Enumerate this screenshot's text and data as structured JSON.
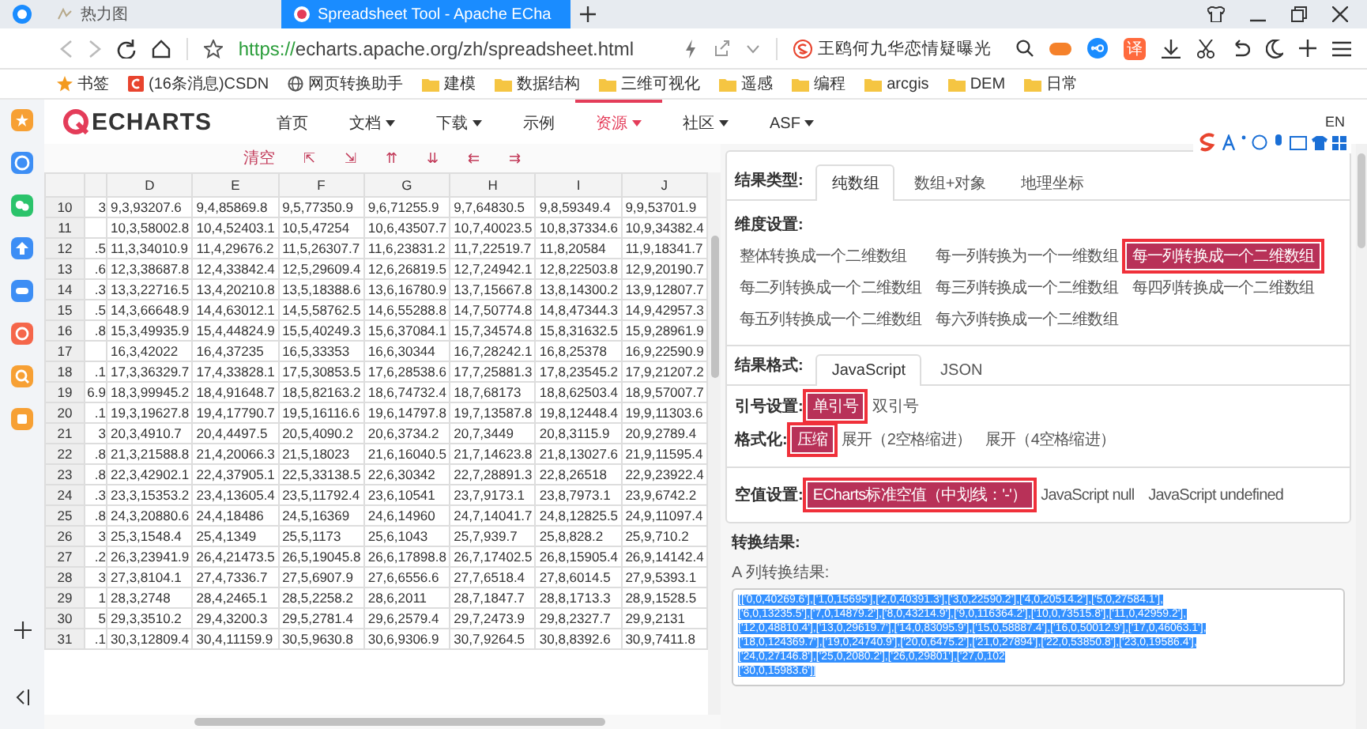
{
  "browser": {
    "tabs": [
      {
        "title": "热力图",
        "selected": false
      },
      {
        "title": "Spreadsheet Tool - Apache ECha",
        "selected": true
      }
    ],
    "url_scheme": "https://",
    "url_host": "echarts.apache.org",
    "url_path": "/zh/spreadsheet.html",
    "search_query": "王鸥何九华恋情疑曝光",
    "translate_label": "译",
    "bookmarks": [
      {
        "label": "书签",
        "kind": "star"
      },
      {
        "label": "(16条消息)CSDN",
        "kind": "csdn"
      },
      {
        "label": "网页转换助手",
        "kind": "globe"
      },
      {
        "label": "建模",
        "kind": "folder"
      },
      {
        "label": "数据结构",
        "kind": "folder"
      },
      {
        "label": "三维可视化",
        "kind": "folder"
      },
      {
        "label": "遥感",
        "kind": "folder"
      },
      {
        "label": "编程",
        "kind": "folder"
      },
      {
        "label": "arcgis",
        "kind": "folder"
      },
      {
        "label": "DEM",
        "kind": "folder"
      },
      {
        "label": "日常",
        "kind": "folder"
      }
    ]
  },
  "site": {
    "logo_text": "ECHARTS",
    "language": "EN",
    "nav": [
      {
        "label": "首页",
        "selected": false,
        "dropdown": false
      },
      {
        "label": "文档",
        "selected": false,
        "dropdown": true
      },
      {
        "label": "下载",
        "selected": false,
        "dropdown": true
      },
      {
        "label": "示例",
        "selected": false,
        "dropdown": false
      },
      {
        "label": "资源",
        "selected": true,
        "dropdown": true
      },
      {
        "label": "社区",
        "selected": false,
        "dropdown": true
      },
      {
        "label": "ASF",
        "selected": false,
        "dropdown": true
      }
    ]
  },
  "toolbar": {
    "clear": "清空",
    "tools": [
      "⇱",
      "⇲",
      "⇈",
      "⇊",
      "⇇",
      "⇉"
    ]
  },
  "table": {
    "columns": [
      "D",
      "E",
      "F",
      "G",
      "H",
      "I",
      "J"
    ],
    "rows": [
      {
        "number": "10",
        "partial": "3",
        "cells": [
          "9,3,93207.6",
          "9,4,85869.8",
          "9,5,77350.9",
          "9,6,71255.9",
          "9,7,64830.5",
          "9,8,59349.4",
          "9,9,53701.9"
        ]
      },
      {
        "number": "11",
        "cells": [
          "10,3,58002.8",
          "10,4,52403.1",
          "10,5,47254",
          "10,6,43507.7",
          "10,7,40023.5",
          "10,8,37334.6",
          "10,9,34382.4"
        ]
      },
      {
        "number": "12",
        "partial": ".5",
        "cells": [
          "11,3,34010.9",
          "11,4,29676.2",
          "11,5,26307.7",
          "11,6,23831.2",
          "11,7,22519.7",
          "11,8,20584",
          "11,9,18341.7"
        ]
      },
      {
        "number": "13",
        "partial": ".6",
        "cells": [
          "12,3,38687.8",
          "12,4,33842.4",
          "12,5,29609.4",
          "12,6,26819.5",
          "12,7,24942.1",
          "12,8,22503.8",
          "12,9,20190.7"
        ]
      },
      {
        "number": "14",
        "partial": ".3",
        "cells": [
          "13,3,22716.5",
          "13,4,20210.8",
          "13,5,18388.6",
          "13,6,16780.9",
          "13,7,15667.8",
          "13,8,14300.2",
          "13,9,12807.7"
        ]
      },
      {
        "number": "15",
        "partial": ".5",
        "cells": [
          "14,3,66648.9",
          "14,4,63012.1",
          "14,5,58762.5",
          "14,6,55288.8",
          "14,7,50774.8",
          "14,8,47344.3",
          "14,9,42957.3"
        ]
      },
      {
        "number": "16",
        "partial": ".8",
        "cells": [
          "15,3,49935.9",
          "15,4,44824.9",
          "15,5,40249.3",
          "15,6,37084.1",
          "15,7,34574.8",
          "15,8,31632.5",
          "15,9,28961.9"
        ]
      },
      {
        "number": "17",
        "cells": [
          "16,3,42022",
          "16,4,37235",
          "16,5,33353",
          "16,6,30344",
          "16,7,28242.1",
          "16,8,25378",
          "16,9,22590.9"
        ]
      },
      {
        "number": "18",
        "partial": ".1",
        "cells": [
          "17,3,36329.7",
          "17,4,33828.1",
          "17,5,30853.5",
          "17,6,28538.6",
          "17,7,25881.3",
          "17,8,23545.2",
          "17,9,21207.2"
        ]
      },
      {
        "number": "19",
        "partial": "6.9",
        "cells": [
          "18,3,99945.2",
          "18,4,91648.7",
          "18,5,82163.2",
          "18,6,74732.4",
          "18,7,68173",
          "18,8,62503.4",
          "18,9,57007.7"
        ]
      },
      {
        "number": "20",
        "partial": ".1",
        "cells": [
          "19,3,19627.8",
          "19,4,17790.7",
          "19,5,16116.6",
          "19,6,14797.8",
          "19,7,13587.8",
          "19,8,12448.4",
          "19,9,11303.6"
        ]
      },
      {
        "number": "21",
        "partial": "3",
        "cells": [
          "20,3,4910.7",
          "20,4,4497.5",
          "20,5,4090.2",
          "20,6,3734.2",
          "20,7,3449",
          "20,8,3115.9",
          "20,9,2789.4"
        ]
      },
      {
        "number": "22",
        "partial": ".8",
        "cells": [
          "21,3,21588.8",
          "21,4,20066.3",
          "21,5,18023",
          "21,6,16040.5",
          "21,7,14623.8",
          "21,8,13027.6",
          "21,9,11595.4"
        ]
      },
      {
        "number": "23",
        "partial": ".8",
        "cells": [
          "22,3,42902.1",
          "22,4,37905.1",
          "22,5,33138.5",
          "22,6,30342",
          "22,7,28891.3",
          "22,8,26518",
          "22,9,23922.4"
        ]
      },
      {
        "number": "24",
        "partial": ".3",
        "cells": [
          "23,3,15353.2",
          "23,4,13605.4",
          "23,5,11792.4",
          "23,6,10541",
          "23,7,9173.1",
          "23,8,7973.1",
          "23,9,6742.2"
        ]
      },
      {
        "number": "25",
        "partial": ".8",
        "cells": [
          "24,3,20880.6",
          "24,4,18486",
          "24,5,16369",
          "24,6,14960",
          "24,7,14041.7",
          "24,8,12825.5",
          "24,9,11097.4"
        ]
      },
      {
        "number": "26",
        "partial": "3",
        "cells": [
          "25,3,1548.4",
          "25,4,1349",
          "25,5,1173",
          "25,6,1043",
          "25,7,939.7",
          "25,8,828.2",
          "25,9,710.2"
        ]
      },
      {
        "number": "27",
        "partial": ".2",
        "cells": [
          "26,3,23941.9",
          "26,4,21473.5",
          "26,5,19045.8",
          "26,6,17898.8",
          "26,7,17402.5",
          "26,8,15905.4",
          "26,9,14142.4"
        ]
      },
      {
        "number": "28",
        "partial": "3",
        "cells": [
          "27,3,8104.1",
          "27,4,7336.7",
          "27,5,6907.9",
          "27,6,6556.6",
          "27,7,6518.4",
          "27,8,6014.5",
          "27,9,5393.1"
        ]
      },
      {
        "number": "29",
        "partial": "1",
        "cells": [
          "28,3,2748",
          "28,4,2465.1",
          "28,5,2258.2",
          "28,6,2011",
          "28,7,1847.7",
          "28,8,1713.3",
          "28,9,1528.5"
        ]
      },
      {
        "number": "30",
        "partial": "5",
        "cells": [
          "29,3,3510.2",
          "29,4,3200.3",
          "29,5,2781.4",
          "29,6,2579.4",
          "29,7,2473.9",
          "29,8,2327.7",
          "29,9,2131"
        ]
      },
      {
        "number": "31",
        "partial": ".1",
        "cells": [
          "30,3,12809.4",
          "30,4,11159.9",
          "30,5,9630.8",
          "30,6,9306.9",
          "30,7,9264.5",
          "30,8,8392.6",
          "30,9,7411.8"
        ]
      }
    ]
  },
  "settings": {
    "result_type": {
      "label": "结果类型:",
      "tabs": [
        {
          "label": "纯数组",
          "selected": true
        },
        {
          "label": "数组+对象",
          "selected": false
        },
        {
          "label": "地理坐标",
          "selected": false
        }
      ]
    },
    "dimension": {
      "label": "维度设置:",
      "options": [
        {
          "label": "整体转换成一个二维数组",
          "selected": false
        },
        {
          "label": "每一列转换为一个一维数组",
          "selected": false
        },
        {
          "label": "每一列转换成一个二维数组",
          "selected": true
        },
        {
          "label": "每二列转换成一个二维数组",
          "selected": false
        },
        {
          "label": "每三列转换成一个二维数组",
          "selected": false
        },
        {
          "label": "每四列转换成一个二维数组",
          "selected": false
        },
        {
          "label": "每五列转换成一个二维数组",
          "selected": false
        },
        {
          "label": "每六列转换成一个二维数组",
          "selected": false
        }
      ]
    },
    "result_format": {
      "label": "结果格式:",
      "tabs": [
        {
          "label": "JavaScript",
          "selected": true
        },
        {
          "label": "JSON",
          "selected": false
        }
      ]
    },
    "quotes": {
      "label": "引号设置:",
      "options": [
        {
          "label": "单引号",
          "selected": true
        },
        {
          "label": "双引号",
          "selected": false
        }
      ]
    },
    "formatting": {
      "label": "格式化:",
      "options": [
        {
          "label": "压缩",
          "selected": true
        },
        {
          "label": "展开（2空格缩进）",
          "selected": false
        },
        {
          "label": "展开（4空格缩进）",
          "selected": false
        }
      ]
    },
    "null_value": {
      "label": "空值设置:",
      "options": [
        {
          "label": "ECharts标准空值（中划线：'-'）",
          "selected": true
        },
        {
          "label": "JavaScript null",
          "selected": false
        },
        {
          "label": "JavaScript undefined",
          "selected": false
        }
      ]
    }
  },
  "result": {
    "heading": "转换结果:",
    "column_label": "A 列转换结果:",
    "text_selected": true,
    "lines": [
      "[['0,0,40269.6'],['1,0,15695'],['2,0,40391.3'],['3,0,22590.2'],['4,0,20514.2'],['5,0,27584.1'],",
      "['6,0,13235.5'],['7,0,14879.2'],['8,0,43214.9'],['9,0,116364.2'],['10,0,73515.8'],['11,0,42959.2'],",
      "['12,0,48810.4'],['13,0,29619.7'],['14,0,83095.9'],['15,0,58887.4'],['16,0,50012.9'],['17,0,46063.1'],",
      "['18,0,124369.7'],['19,0,24740.9'],['20,0,6475.2'],['21,0,27894'],['22,0,53850.8'],['23,0,19586.4'],",
      "['24,0,27146.8'],['25,0,2080.2'],['26,0,29801'],['27,0,102",
      "['30,0,15983.6']]"
    ]
  }
}
